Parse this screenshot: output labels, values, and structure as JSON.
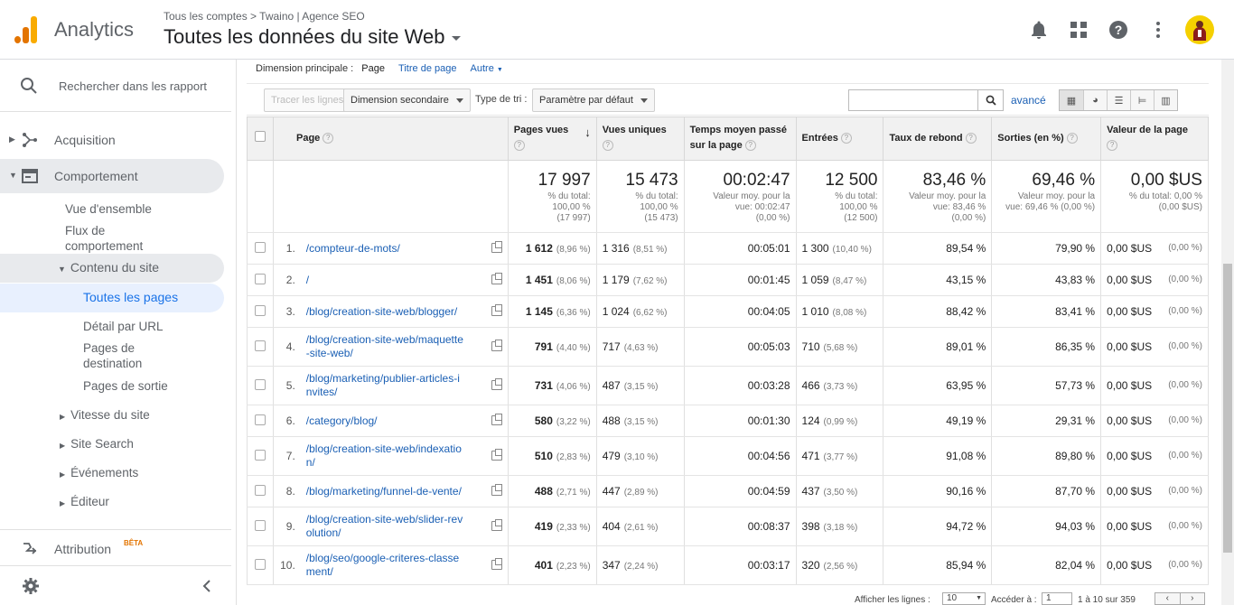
{
  "header": {
    "app_name": "Analytics",
    "breadcrumb": "Tous les comptes > Twaino | Agence SEO",
    "view_title": "Toutes les données du site Web"
  },
  "sidebar": {
    "search_placeholder": "Rechercher dans les rapport",
    "acquisition": "Acquisition",
    "comportement": "Comportement",
    "vue_ensemble": "Vue d'ensemble",
    "flux_1": "Flux de",
    "flux_2": "comportement",
    "contenu": "Contenu du site",
    "toutes_pages": "Toutes les pages",
    "detail_url": "Détail par URL",
    "pages_dest_1": "Pages de",
    "pages_dest_2": "destination",
    "pages_sortie": "Pages de sortie",
    "vitesse": "Vitesse du site",
    "site_search": "Site Search",
    "evenements": "Événements",
    "editeur": "Éditeur",
    "attribution": "Attribution",
    "beta": "BÊTA"
  },
  "toolbar": {
    "dim_label": "Dimension principale :",
    "dim_page": "Page",
    "dim_titre": "Titre de page",
    "dim_autre": "Autre",
    "tracer": "Tracer les lignes",
    "dimension_secondaire": "Dimension secondaire",
    "type_tri": "Type de tri :",
    "parametre": "Paramètre par défaut",
    "avance": "avancé"
  },
  "table": {
    "headers": {
      "page": "Page",
      "pages_vues": "Pages vues",
      "vues_uniques": "Vues uniques",
      "temps_1": "Temps moyen passé",
      "temps_2": "sur la page",
      "entrees": "Entrées",
      "rebond": "Taux de rebond",
      "sorties": "Sorties (en %)",
      "valeur": "Valeur de la page"
    },
    "totals": {
      "pages_vues": "17 997",
      "pages_vues_sub": [
        "% du total:",
        "100,00 %",
        "(17 997)"
      ],
      "vues_uniques": "15 473",
      "vues_uniques_sub": [
        "% du total:",
        "100,00 %",
        "(15 473)"
      ],
      "temps": "00:02:47",
      "temps_sub": [
        "Valeur moy. pour la",
        "vue: 00:02:47",
        "(0,00 %)"
      ],
      "entrees": "12 500",
      "entrees_sub": [
        "% du total:",
        "100,00 %",
        "(12 500)"
      ],
      "rebond": "83,46 %",
      "rebond_sub": [
        "Valeur moy. pour la",
        "vue: 83,46 %",
        "(0,00 %)"
      ],
      "sorties": "69,46 %",
      "sorties_sub": [
        "Valeur moy. pour la",
        "vue: 69,46 % (0,00 %)"
      ],
      "valeur": "0,00 $US",
      "valeur_sub": [
        "% du total: 0,00 %",
        "(0,00 $US)"
      ]
    },
    "rows": [
      {
        "n": "1.",
        "page": [
          "/compteur-de-mots/"
        ],
        "pv": "1 612",
        "pv_p": "(8,96 %)",
        "vu": "1 316",
        "vu_p": "(8,51 %)",
        "t": "00:05:01",
        "e": "1 300",
        "e_p": "(10,40 %)",
        "r": "89,54 %",
        "s": "79,90 %",
        "v": "0,00 $US",
        "v_p": "(0,00 %)"
      },
      {
        "n": "2.",
        "page": [
          "/"
        ],
        "pv": "1 451",
        "pv_p": "(8,06 %)",
        "vu": "1 179",
        "vu_p": "(7,62 %)",
        "t": "00:01:45",
        "e": "1 059",
        "e_p": "(8,47 %)",
        "r": "43,15 %",
        "s": "43,83 %",
        "v": "0,00 $US",
        "v_p": "(0,00 %)"
      },
      {
        "n": "3.",
        "page": [
          "/blog/creation-site-web/blogger/"
        ],
        "pv": "1 145",
        "pv_p": "(6,36 %)",
        "vu": "1 024",
        "vu_p": "(6,62 %)",
        "t": "00:04:05",
        "e": "1 010",
        "e_p": "(8,08 %)",
        "r": "88,42 %",
        "s": "83,41 %",
        "v": "0,00 $US",
        "v_p": "(0,00 %)"
      },
      {
        "n": "4.",
        "page": [
          "/blog/creation-site-web/maquette",
          "-site-web/"
        ],
        "pv": "791",
        "pv_p": "(4,40 %)",
        "vu": "717",
        "vu_p": "(4,63 %)",
        "t": "00:05:03",
        "e": "710",
        "e_p": "(5,68 %)",
        "r": "89,01 %",
        "s": "86,35 %",
        "v": "0,00 $US",
        "v_p": "(0,00 %)"
      },
      {
        "n": "5.",
        "page": [
          "/blog/marketing/publier-articles-i",
          "nvites/"
        ],
        "pv": "731",
        "pv_p": "(4,06 %)",
        "vu": "487",
        "vu_p": "(3,15 %)",
        "t": "00:03:28",
        "e": "466",
        "e_p": "(3,73 %)",
        "r": "63,95 %",
        "s": "57,73 %",
        "v": "0,00 $US",
        "v_p": "(0,00 %)"
      },
      {
        "n": "6.",
        "page": [
          "/category/blog/"
        ],
        "pv": "580",
        "pv_p": "(3,22 %)",
        "vu": "488",
        "vu_p": "(3,15 %)",
        "t": "00:01:30",
        "e": "124",
        "e_p": "(0,99 %)",
        "r": "49,19 %",
        "s": "29,31 %",
        "v": "0,00 $US",
        "v_p": "(0,00 %)"
      },
      {
        "n": "7.",
        "page": [
          "/blog/creation-site-web/indexatio",
          "n/"
        ],
        "pv": "510",
        "pv_p": "(2,83 %)",
        "vu": "479",
        "vu_p": "(3,10 %)",
        "t": "00:04:56",
        "e": "471",
        "e_p": "(3,77 %)",
        "r": "91,08 %",
        "s": "89,80 %",
        "v": "0,00 $US",
        "v_p": "(0,00 %)"
      },
      {
        "n": "8.",
        "page": [
          "/blog/marketing/funnel-de-vente/"
        ],
        "pv": "488",
        "pv_p": "(2,71 %)",
        "vu": "447",
        "vu_p": "(2,89 %)",
        "t": "00:04:59",
        "e": "437",
        "e_p": "(3,50 %)",
        "r": "90,16 %",
        "s": "87,70 %",
        "v": "0,00 $US",
        "v_p": "(0,00 %)"
      },
      {
        "n": "9.",
        "page": [
          "/blog/creation-site-web/slider-rev",
          "olution/"
        ],
        "pv": "419",
        "pv_p": "(2,33 %)",
        "vu": "404",
        "vu_p": "(2,61 %)",
        "t": "00:08:37",
        "e": "398",
        "e_p": "(3,18 %)",
        "r": "94,72 %",
        "s": "94,03 %",
        "v": "0,00 $US",
        "v_p": "(0,00 %)"
      },
      {
        "n": "10.",
        "page": [
          "/blog/seo/google-criteres-classe",
          "ment/"
        ],
        "pv": "401",
        "pv_p": "(2,23 %)",
        "vu": "347",
        "vu_p": "(2,24 %)",
        "t": "00:03:17",
        "e": "320",
        "e_p": "(2,56 %)",
        "r": "85,94 %",
        "s": "82,04 %",
        "v": "0,00 $US",
        "v_p": "(0,00 %)"
      }
    ]
  },
  "pagination": {
    "afficher": "Afficher les lignes :",
    "rows_value": "10",
    "acceder": "Accéder à :",
    "page_value": "1",
    "range": "1 à 10 sur 359"
  }
}
